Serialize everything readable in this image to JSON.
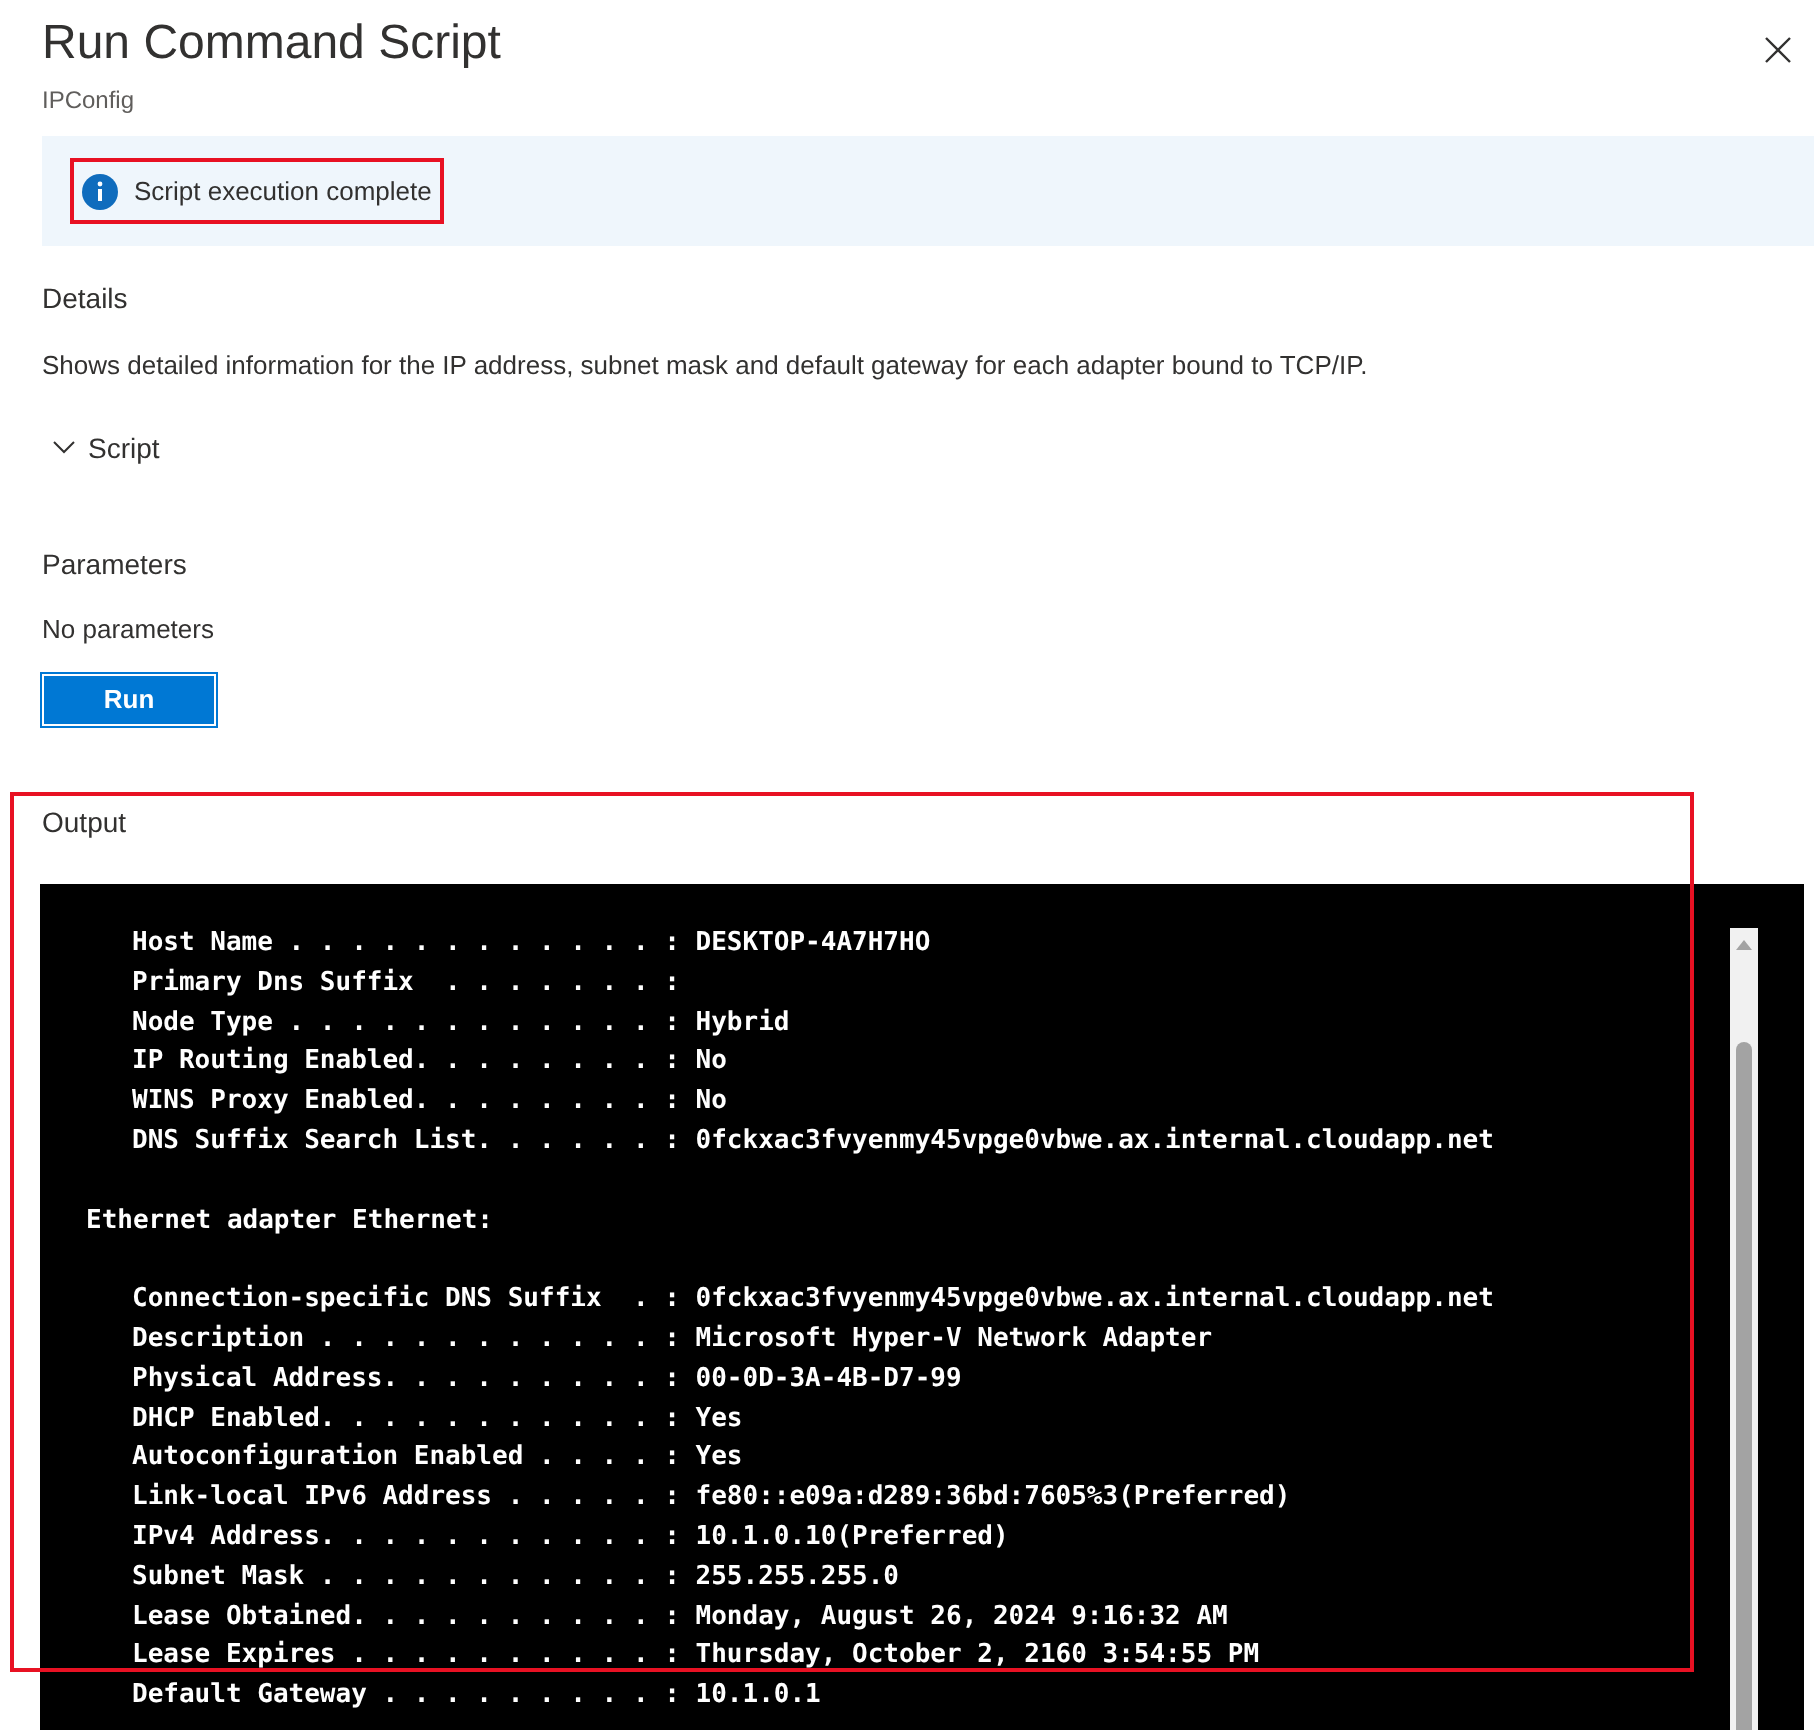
{
  "panel": {
    "title": "Run Command Script",
    "subtitle": "IPConfig"
  },
  "notice": {
    "text": "Script execution complete",
    "highlighted": true
  },
  "details": {
    "heading": "Details",
    "description": "Shows detailed information for the IP address, subnet mask and default gateway for each adapter bound to TCP/IP."
  },
  "script_section": {
    "label": "Script",
    "expanded": false
  },
  "parameters": {
    "heading": "Parameters",
    "text": "No parameters"
  },
  "run_button": {
    "label": "Run",
    "focused": true
  },
  "output": {
    "heading": "Output",
    "highlighted": true,
    "lines": [
      {
        "kind": "field",
        "text": "Host Name . . . . . . . . . . . . : DESKTOP-4A7H7HO"
      },
      {
        "kind": "field",
        "text": "Primary Dns Suffix  . . . . . . . :"
      },
      {
        "kind": "field",
        "text": "Node Type . . . . . . . . . . . . : Hybrid"
      },
      {
        "kind": "field",
        "text": "IP Routing Enabled. . . . . . . . : No"
      },
      {
        "kind": "field",
        "text": "WINS Proxy Enabled. . . . . . . . : No"
      },
      {
        "kind": "field",
        "text": "DNS Suffix Search List. . . . . . : 0fckxac3fvyenmy45vpge0vbwe.ax.internal.cloudapp.net"
      },
      {
        "kind": "blank"
      },
      {
        "kind": "heading",
        "text": "Ethernet adapter Ethernet:"
      },
      {
        "kind": "blank"
      },
      {
        "kind": "field",
        "text": "Connection-specific DNS Suffix  . : 0fckxac3fvyenmy45vpge0vbwe.ax.internal.cloudapp.net"
      },
      {
        "kind": "field",
        "text": "Description . . . . . . . . . . . : Microsoft Hyper-V Network Adapter"
      },
      {
        "kind": "field",
        "text": "Physical Address. . . . . . . . . : 00-0D-3A-4B-D7-99"
      },
      {
        "kind": "field",
        "text": "DHCP Enabled. . . . . . . . . . . : Yes"
      },
      {
        "kind": "field",
        "text": "Autoconfiguration Enabled . . . . : Yes"
      },
      {
        "kind": "field",
        "text": "Link-local IPv6 Address . . . . . : fe80::e09a:d289:36bd:7605%3(Preferred)"
      },
      {
        "kind": "field",
        "text": "IPv4 Address. . . . . . . . . . . : 10.1.0.10(Preferred)"
      },
      {
        "kind": "field",
        "text": "Subnet Mask . . . . . . . . . . . : 255.255.255.0"
      },
      {
        "kind": "field",
        "text": "Lease Obtained. . . . . . . . . . : Monday, August 26, 2024 9:16:32 AM"
      },
      {
        "kind": "field",
        "text": "Lease Expires . . . . . . . . . . : Thursday, October 2, 2160 3:54:55 PM"
      },
      {
        "kind": "field",
        "text": "Default Gateway . . . . . . . . . : 10.1.0.1"
      }
    ]
  }
}
